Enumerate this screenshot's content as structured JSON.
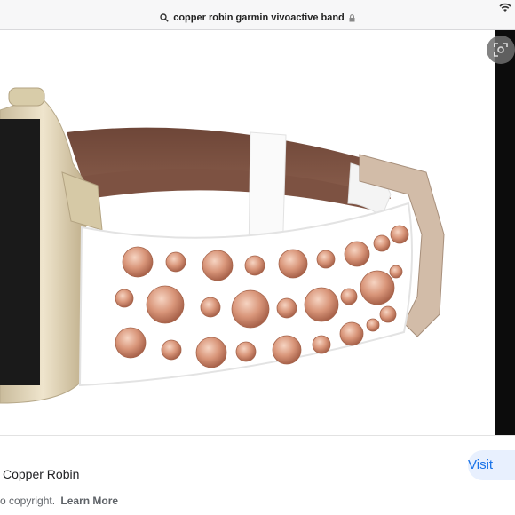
{
  "address_bar": {
    "query": "copper robin garmin vivoactive band",
    "search_icon": "search-icon",
    "lock_icon": "lock-icon"
  },
  "status_bar": {
    "wifi_icon": "wifi-icon"
  },
  "image_viewer": {
    "image_description_icon": "band-photo",
    "lens_icon": "lens-icon"
  },
  "result": {
    "title": "Copper Robin",
    "visit_label": "Visit",
    "copyright_text": "o copyright.",
    "learn_more_label": "Learn More"
  },
  "colors": {
    "accent": "#1a73e8",
    "visit_bg": "#e8f0fe",
    "copper": "#d9967a"
  }
}
